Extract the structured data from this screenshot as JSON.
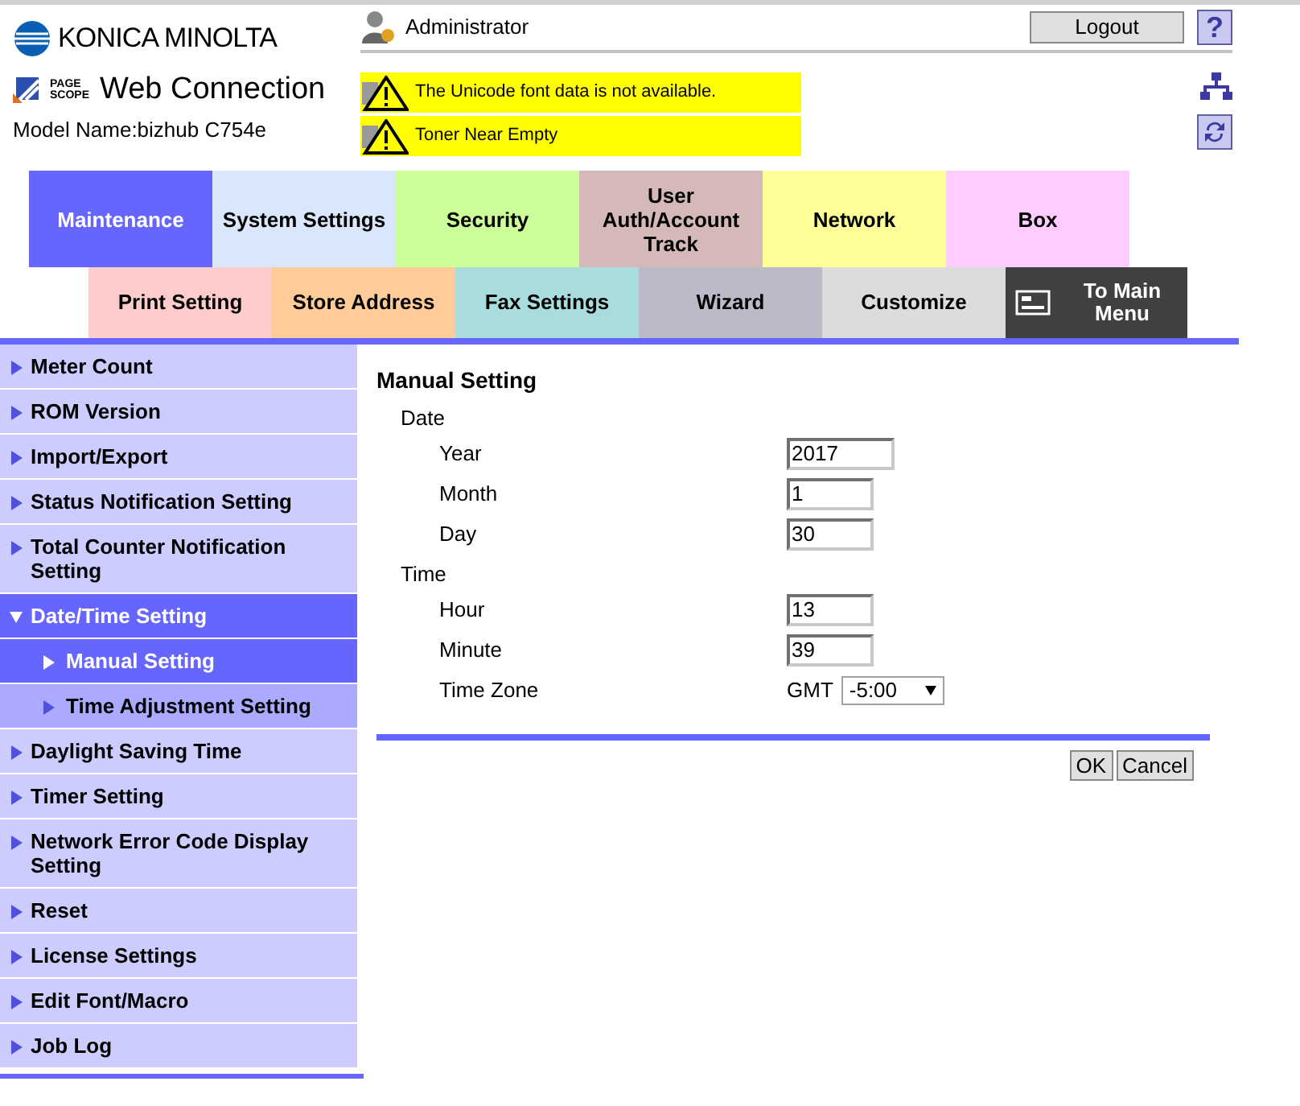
{
  "header": {
    "brand": "KONICA MINOLTA",
    "product_mark": "PAGE SCOPE",
    "product": "Web Connection",
    "model": "Model Name:bizhub C754e",
    "user": "Administrator",
    "logout": "Logout",
    "help": "?",
    "alerts": [
      "The Unicode font data is not available.",
      "Toner Near Empty"
    ]
  },
  "tabs": [
    {
      "label": "Maintenance",
      "selected": true,
      "color": "#6666ff"
    },
    {
      "label": "System Settings",
      "selected": false,
      "color": "#dae6fb"
    },
    {
      "label": "Security",
      "selected": false,
      "color": "#ccff99"
    },
    {
      "label": "User Auth/Account Track",
      "selected": false,
      "color": "#d5b8b8"
    },
    {
      "label": "Network",
      "selected": false,
      "color": "#ffff99"
    },
    {
      "label": "Box",
      "selected": false,
      "color": "#ffccff"
    }
  ],
  "subtabs": [
    {
      "label": "Print Setting",
      "kind": "tab",
      "color": "#ffcccc"
    },
    {
      "label": "Store Address",
      "kind": "tab",
      "color": "#ffcc99"
    },
    {
      "label": "Fax Settings",
      "kind": "tab",
      "color": "#a9dcdc"
    },
    {
      "label": "Wizard",
      "kind": "tab",
      "color": "#bcb9c9"
    },
    {
      "label": "Customize",
      "kind": "tab",
      "color": "#dcdcdc"
    },
    {
      "label": "To Main Menu",
      "kind": "home",
      "color": "#404040"
    }
  ],
  "sidebar": {
    "items": [
      {
        "label": "Meter Count",
        "selected": false,
        "expanded": false
      },
      {
        "label": "ROM Version",
        "selected": false,
        "expanded": false
      },
      {
        "label": "Import/Export",
        "selected": false,
        "expanded": false
      },
      {
        "label": "Status Notification Setting",
        "selected": false,
        "expanded": false
      },
      {
        "label": "Total Counter Notification Setting",
        "selected": false,
        "expanded": false
      },
      {
        "label": "Date/Time Setting",
        "selected": true,
        "expanded": true,
        "children": [
          {
            "label": "Manual Setting",
            "selected": true
          },
          {
            "label": "Time Adjustment Setting",
            "selected": false
          }
        ]
      },
      {
        "label": "Daylight Saving Time",
        "selected": false,
        "expanded": false
      },
      {
        "label": "Timer Setting",
        "selected": false,
        "expanded": false
      },
      {
        "label": "Network Error Code Display Setting",
        "selected": false,
        "expanded": false
      },
      {
        "label": "Reset",
        "selected": false,
        "expanded": false
      },
      {
        "label": "License Settings",
        "selected": false,
        "expanded": false
      },
      {
        "label": "Edit Font/Macro",
        "selected": false,
        "expanded": false
      },
      {
        "label": "Job Log",
        "selected": false,
        "expanded": false
      }
    ]
  },
  "form": {
    "title": "Manual Setting",
    "groups": [
      {
        "label": "Date",
        "fields": [
          {
            "label": "Year",
            "value": "2017",
            "kind": "wide"
          },
          {
            "label": "Month",
            "value": "1",
            "kind": "short"
          },
          {
            "label": "Day",
            "value": "30",
            "kind": "short"
          }
        ]
      },
      {
        "label": "Time",
        "fields": [
          {
            "label": "Hour",
            "value": "13",
            "kind": "short"
          },
          {
            "label": "Minute",
            "value": "39",
            "kind": "short"
          },
          {
            "label": "Time Zone",
            "prefix": "GMT",
            "value": "-5:00",
            "kind": "select"
          }
        ]
      }
    ],
    "buttons": [
      "OK",
      "Cancel"
    ]
  }
}
